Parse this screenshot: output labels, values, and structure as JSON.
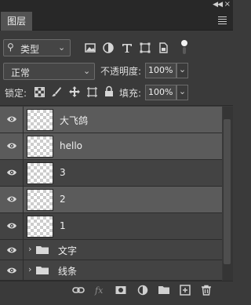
{
  "panel": {
    "tab_label": "图层",
    "collapse_icon": "double-chevron-icon",
    "close_icon": "close-icon",
    "menu_icon": "hamburger-menu-icon"
  },
  "filter": {
    "kind_label": "类型",
    "icons": [
      "image-filter-icon",
      "adjustment-filter-icon",
      "type-filter-icon",
      "shape-filter-icon",
      "smart-object-filter-icon",
      "filter-toggle-icon"
    ]
  },
  "blend": {
    "mode": "正常",
    "opacity_label": "不透明度:",
    "opacity_value": "100%"
  },
  "lock": {
    "label": "锁定:",
    "fill_label": "填充:",
    "fill_value": "100%",
    "icons": [
      "lock-transparency-icon",
      "lock-pixels-icon",
      "lock-position-icon",
      "lock-artboard-icon",
      "lock-all-icon"
    ]
  },
  "layers": [
    {
      "name": "大飞鸽",
      "selected": true
    },
    {
      "name": "hello",
      "selected": true
    },
    {
      "name": "3",
      "selected": false
    },
    {
      "name": "2",
      "selected": true
    },
    {
      "name": "1",
      "selected": false
    }
  ],
  "groups": [
    {
      "name": "文字"
    },
    {
      "name": "线条"
    }
  ],
  "bottom_icons": [
    "link-layers-icon",
    "fx-icon",
    "add-mask-icon",
    "adjustment-layer-icon",
    "new-group-icon",
    "new-layer-icon",
    "delete-layer-icon"
  ],
  "colors": {
    "panel_bg": "#3a3a3a",
    "selected_row": "#5b5b5b",
    "row_bg": "#434343"
  }
}
